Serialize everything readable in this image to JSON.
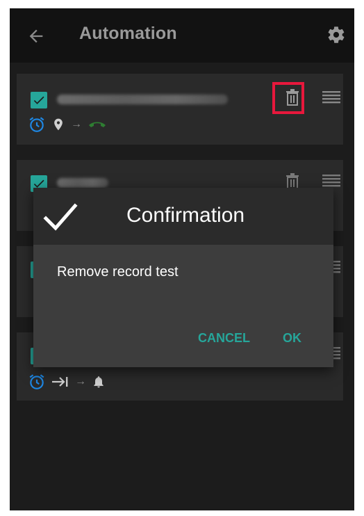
{
  "appbar": {
    "title": "Automation",
    "back_icon": "arrow-left-icon",
    "settings_icon": "gear-icon"
  },
  "rules": [
    {
      "checked": true,
      "name_obscured": true,
      "trigger_icons": [
        "alarm-icon",
        "location-pin-icon"
      ],
      "action_icons": [
        "call-end-icon"
      ],
      "delete_highlighted": true
    },
    {
      "checked": true,
      "name_obscured": true
    },
    {
      "checked": true,
      "name_obscured": false
    },
    {
      "checked": true,
      "trigger_icons": [
        "alarm-icon",
        "skip-next-icon"
      ],
      "action_icons": [
        "bell-icon"
      ]
    }
  ],
  "dialog": {
    "title": "Confirmation",
    "message": "Remove record test",
    "cancel_label": "CANCEL",
    "ok_label": "OK"
  },
  "colors": {
    "accent": "#26a69a",
    "highlight": "#e8183c",
    "alarm": "#1e88e5",
    "action": "#2e7d32"
  }
}
